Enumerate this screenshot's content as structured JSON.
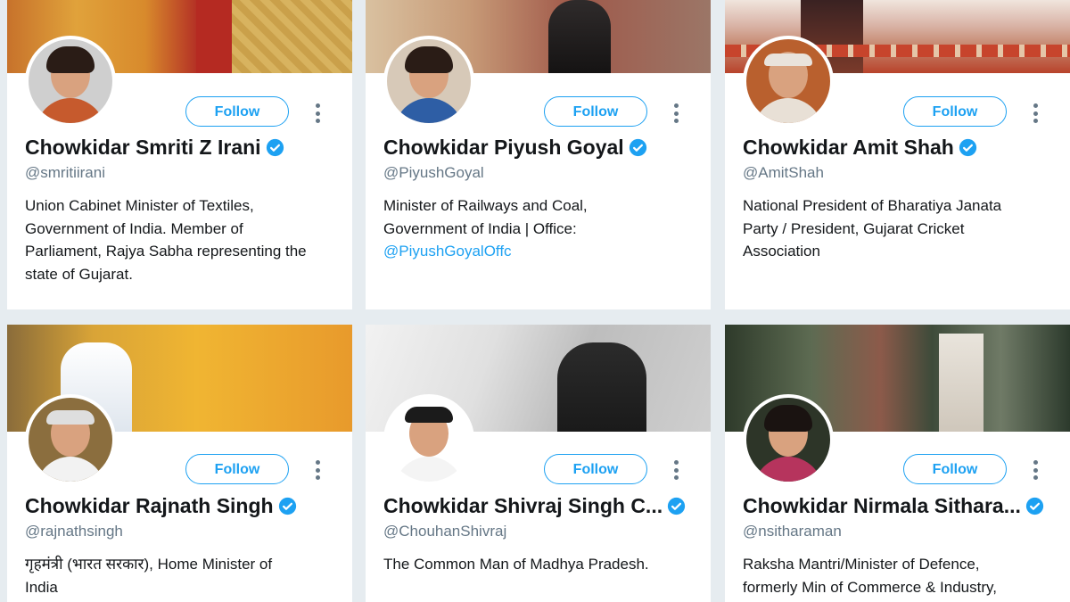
{
  "colors": {
    "accent": "#1da1f2",
    "background": "#e6ecf0",
    "text": "#14171a",
    "secondary": "#657786"
  },
  "follow_label": "Follow",
  "cards": [
    {
      "name": "Chowkidar Smriti Z Irani",
      "handle": "@smritiirani",
      "bio_lines": [
        "Union Cabinet Minister of Textiles,",
        "Government of India. Member of",
        "Parliament, Rajya Sabha representing the",
        "state of Gujarat."
      ],
      "verified": true
    },
    {
      "name": "Chowkidar Piyush Goyal",
      "handle": "@PiyushGoyal",
      "bio_lines": [
        "Minister of Railways and Coal,",
        "Government of India | Office:"
      ],
      "bio_link": "@PiyushGoyalOffc",
      "verified": true
    },
    {
      "name": "Chowkidar Amit Shah",
      "handle": "@AmitShah",
      "bio_lines": [
        "National President of Bharatiya Janata",
        "Party / President, Gujarat Cricket",
        "Association"
      ],
      "verified": true
    },
    {
      "name": "Chowkidar Rajnath Singh",
      "handle": "@rajnathsingh",
      "bio_lines": [
        "गृहमंत्री (भारत सरकार), Home Minister of",
        "India"
      ],
      "verified": true
    },
    {
      "name": "Chowkidar Shivraj Singh C...",
      "handle": "@ChouhanShivraj",
      "bio_lines": [
        "The Common Man of Madhya Pradesh."
      ],
      "verified": true
    },
    {
      "name": "Chowkidar Nirmala Sithara...",
      "handle": "@nsitharaman",
      "bio_lines": [
        "Raksha Mantri/Minister of Defence,",
        "formerly Min of Commerce & Industry,"
      ],
      "verified": true
    }
  ]
}
